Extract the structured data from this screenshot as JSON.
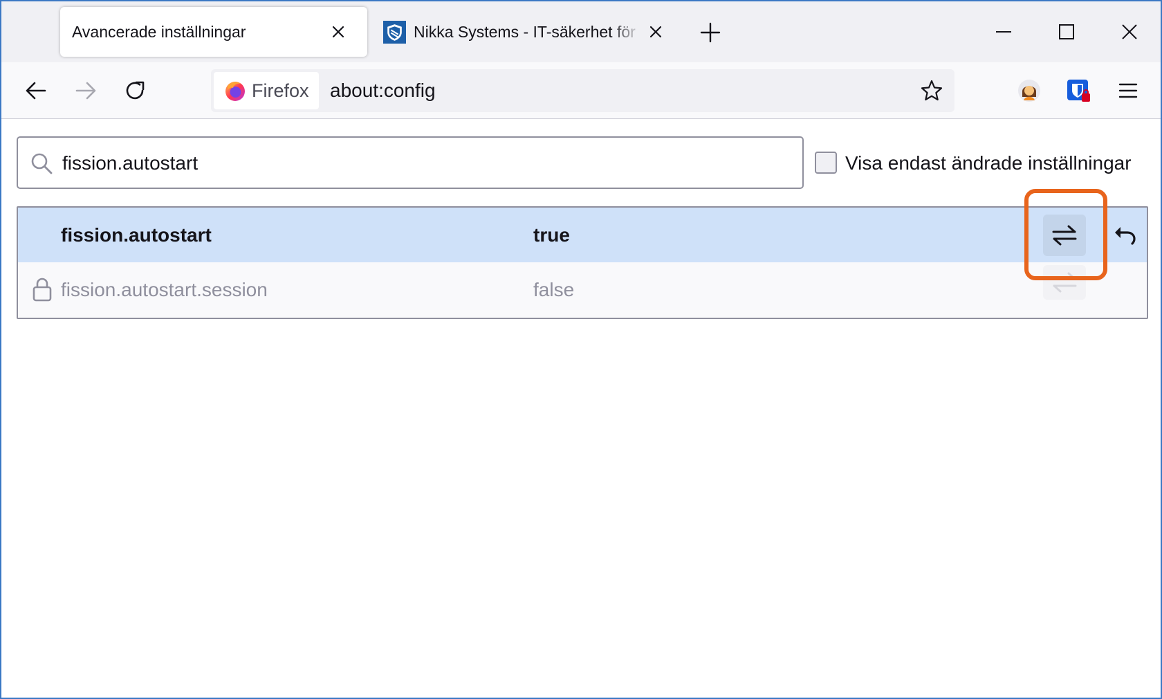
{
  "tabs": [
    {
      "title": "Avancerade inställningar",
      "active": true,
      "favicon": "none"
    },
    {
      "title": "Nikka Systems - IT-säkerhet för",
      "active": false,
      "favicon": "shield-icon"
    }
  ],
  "window_controls": [
    "minimize-icon",
    "maximize-icon",
    "close-icon"
  ],
  "navbar": {
    "identity_label": "Firefox",
    "url": "about:config"
  },
  "search": {
    "value": "fission.autostart",
    "show_modified_label": "Visa endast ändrade inställningar",
    "show_modified_checked": false
  },
  "prefs": [
    {
      "name": "fission.autostart",
      "value": "true",
      "modified": true,
      "locked": false
    },
    {
      "name": "fission.autostart.session",
      "value": "false",
      "modified": false,
      "locked": true
    }
  ],
  "colors": {
    "accent_border": "#3b78c4",
    "highlight": "#e8641c",
    "modified_row": "#cfe1f9"
  }
}
